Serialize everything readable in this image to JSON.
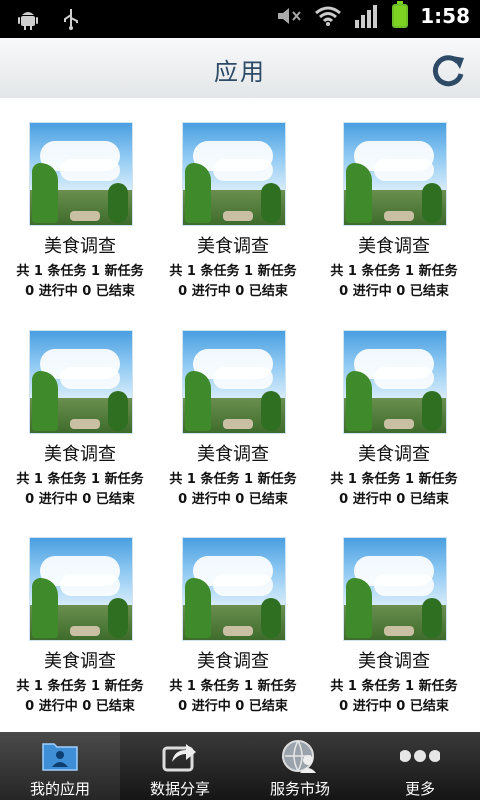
{
  "status_bar": {
    "time": "1:58"
  },
  "header": {
    "title": "应用"
  },
  "apps": [
    {
      "name": "美食调查",
      "line1": "共 1 条任务 1 新任务",
      "line2": "0 进行中 0 已结束"
    },
    {
      "name": "美食调查",
      "line1": "共 1 条任务 1 新任务",
      "line2": "0 进行中 0 已结束"
    },
    {
      "name": "美食调查",
      "line1": "共 1 条任务 1 新任务",
      "line2": "0 进行中 0 已结束"
    },
    {
      "name": "美食调查",
      "line1": "共 1 条任务 1 新任务",
      "line2": "0 进行中 0 已结束"
    },
    {
      "name": "美食调查",
      "line1": "共 1 条任务 1 新任务",
      "line2": "0 进行中 0 已结束"
    },
    {
      "name": "美食调查",
      "line1": "共 1 条任务 1 新任务",
      "line2": "0 进行中 0 已结束"
    },
    {
      "name": "美食调查",
      "line1": "共 1 条任务 1 新任务",
      "line2": "0 进行中 0 已结束"
    },
    {
      "name": "美食调查",
      "line1": "共 1 条任务 1 新任务",
      "line2": "0 进行中 0 已结束"
    },
    {
      "name": "美食调查",
      "line1": "共 1 条任务 1 新任务",
      "line2": "0 进行中 0 已结束"
    }
  ],
  "tabs": [
    {
      "label": "我的应用",
      "icon": "folder-user-icon",
      "active": true
    },
    {
      "label": "数据分享",
      "icon": "share-arrow-icon",
      "active": false
    },
    {
      "label": "服务市场",
      "icon": "globe-user-icon",
      "active": false
    },
    {
      "label": "更多",
      "icon": "more-dots-icon",
      "active": false
    }
  ],
  "colors": {
    "title": "#2d4a66",
    "battery": "#7ed321",
    "tabbar": "#1f1f1f"
  }
}
